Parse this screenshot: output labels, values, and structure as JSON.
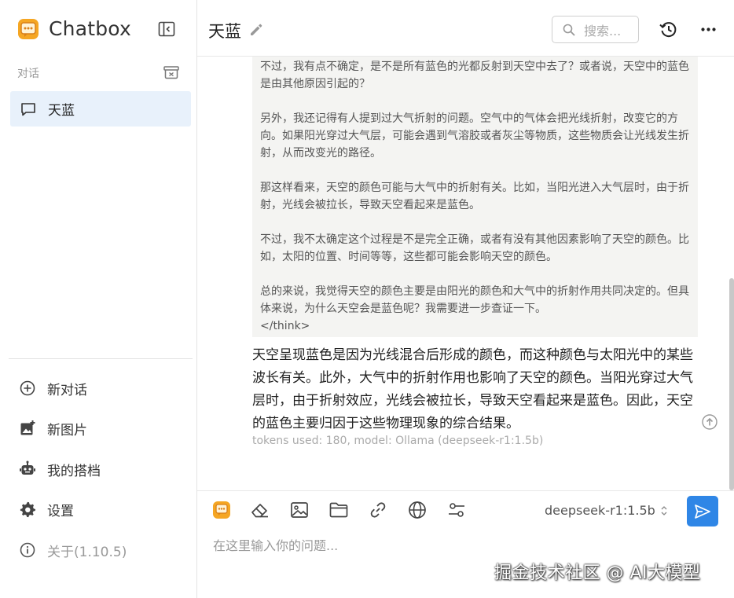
{
  "sidebar": {
    "app_name": "Chatbox",
    "section_label": "对话",
    "conversations": [
      {
        "label": "天蓝",
        "selected": true
      }
    ],
    "menu": {
      "new_chat": "新对话",
      "new_image": "新图片",
      "my_partner": "我的搭档",
      "settings": "设置",
      "about": "关于(1.10.5)"
    }
  },
  "header": {
    "title": "天蓝",
    "search_placeholder": "搜索..."
  },
  "chat": {
    "think_paragraphs": [
      "不过，我有点不确定，是不是所有蓝色的光都反射到天空中去了？或者说，天空中的蓝色是由其他原因引起的？",
      "另外，我还记得有人提到过大气折射的问题。空气中的气体会把光线折射，改变它的方向。如果阳光穿过大气层，可能会遇到气溶胶或者灰尘等物质，这些物质会让光线发生折射，从而改变光的路径。",
      "那这样看来，天空的颜色可能与大气中的折射有关。比如，当阳光进入大气层时，由于折射，光线会被拉长，导致天空看起来是蓝色。",
      "不过，我不太确定这个过程是不是完全正确，或者有没有其他因素影响了天空的颜色。比如，太阳的位置、时间等等，这些都可能会影响天空的颜色。",
      "总的来说，我觉得天空的颜色主要是由阳光的颜色和大气中的折射作用共同决定的。但具体来说，为什么天空会是蓝色呢？我需要进一步查证一下。"
    ],
    "think_close": "</think>",
    "answer": "天空呈现蓝色是因为光线混合后形成的颜色，而这种颜色与太阳光中的某些波长有关。此外，大气中的折射作用也影响了天空的颜色。当阳光穿过大气层时，由于折射效应，光线会被拉长，导致天空看起来是蓝色。因此，天空的蓝色主要归因于这些物理现象的综合结果。",
    "meta": "tokens used: 180, model: Ollama (deepseek-r1:1.5b)"
  },
  "input": {
    "model": "deepseek-r1:1.5b",
    "placeholder": "在这里输入你的问题...",
    "watermark": "掘金技术社区 @ AI大模型"
  },
  "colors": {
    "accent": "#2f86e6",
    "selected_bg": "#e8f1fb",
    "think_bg": "#f4f4f2",
    "logo_orange": "#f5a623"
  }
}
